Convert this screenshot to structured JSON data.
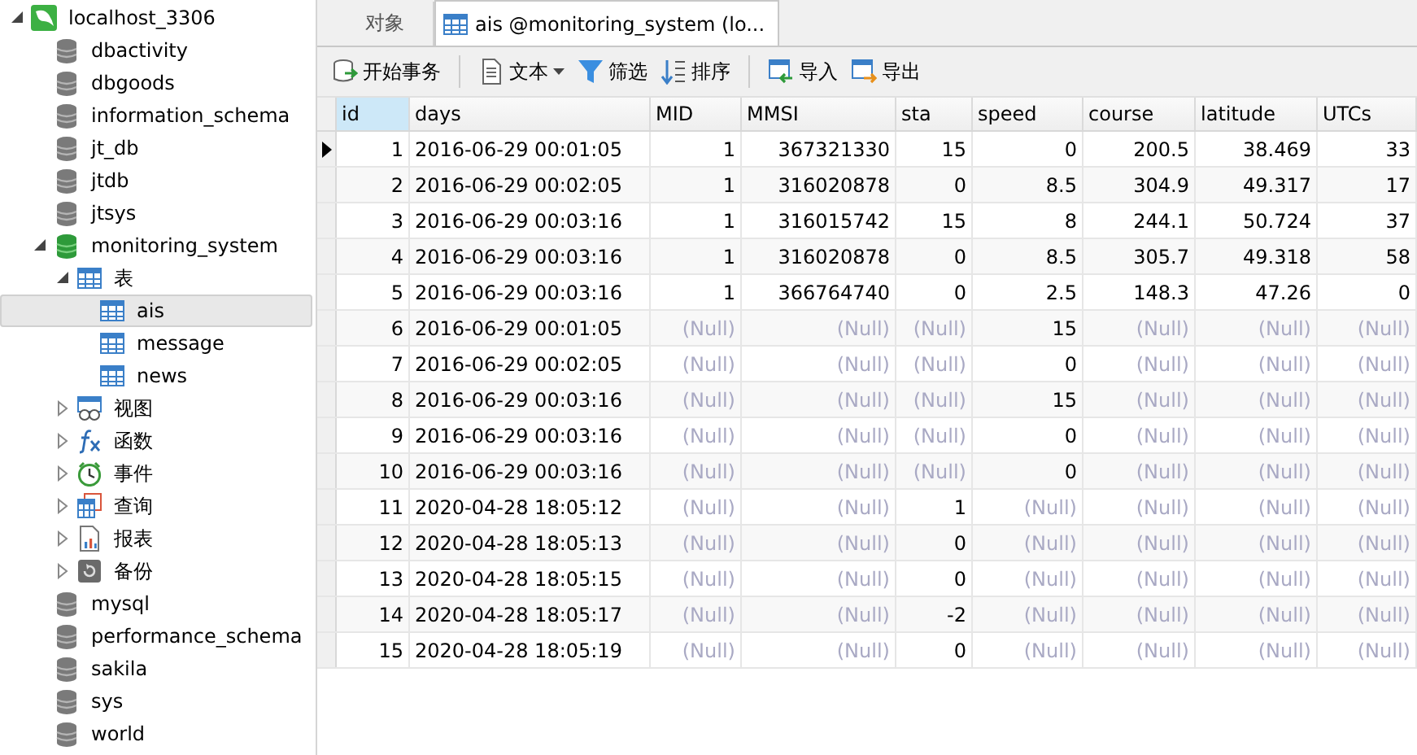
{
  "sidebar": {
    "tree": [
      {
        "kind": "server",
        "label": "localhost_3306",
        "expanded": true,
        "selected": false,
        "children": [
          {
            "kind": "database",
            "label": "dbactivity",
            "open": false,
            "selected": false
          },
          {
            "kind": "database",
            "label": "dbgoods",
            "open": false,
            "selected": false
          },
          {
            "kind": "database",
            "label": "information_schema",
            "open": false,
            "selected": false
          },
          {
            "kind": "database",
            "label": "jt_db",
            "open": false,
            "selected": false
          },
          {
            "kind": "database",
            "label": "jtdb",
            "open": false,
            "selected": false
          },
          {
            "kind": "database",
            "label": "jtsys",
            "open": false,
            "selected": false
          },
          {
            "kind": "database",
            "label": "monitoring_system",
            "open": true,
            "expanded": true,
            "selected": false,
            "children": [
              {
                "kind": "tables",
                "label": "表",
                "expanded": true,
                "selected": false,
                "children": [
                  {
                    "kind": "table",
                    "label": "ais",
                    "selected": true
                  },
                  {
                    "kind": "table",
                    "label": "message",
                    "selected": false
                  },
                  {
                    "kind": "table",
                    "label": "news",
                    "selected": false
                  }
                ]
              },
              {
                "kind": "views",
                "label": "视图",
                "expanded": false,
                "selected": false
              },
              {
                "kind": "functions",
                "label": "函数",
                "expanded": false,
                "selected": false
              },
              {
                "kind": "events",
                "label": "事件",
                "expanded": false,
                "selected": false
              },
              {
                "kind": "queries",
                "label": "查询",
                "expanded": false,
                "selected": false
              },
              {
                "kind": "reports",
                "label": "报表",
                "expanded": false,
                "selected": false
              },
              {
                "kind": "backups",
                "label": "备份",
                "expanded": false,
                "selected": false
              }
            ]
          },
          {
            "kind": "database",
            "label": "mysql",
            "open": false,
            "selected": false
          },
          {
            "kind": "database",
            "label": "performance_schema",
            "open": false,
            "selected": false
          },
          {
            "kind": "database",
            "label": "sakila",
            "open": false,
            "selected": false
          },
          {
            "kind": "database",
            "label": "sys",
            "open": false,
            "selected": false
          },
          {
            "kind": "database",
            "label": "world",
            "open": false,
            "selected": false
          }
        ]
      }
    ]
  },
  "tabs": [
    {
      "kind": "objects",
      "label": "对象",
      "selected": false
    },
    {
      "kind": "table",
      "label": "ais @monitoring_system (lo...",
      "selected": true
    }
  ],
  "toolbar": [
    {
      "kind": "transaction",
      "label": "开始事务"
    },
    {
      "kind": "separator"
    },
    {
      "kind": "text",
      "label": "文本",
      "dropdown": true
    },
    {
      "kind": "filter",
      "label": "筛选"
    },
    {
      "kind": "sort",
      "label": "排序"
    },
    {
      "kind": "separator"
    },
    {
      "kind": "import",
      "label": "导入"
    },
    {
      "kind": "export",
      "label": "导出"
    }
  ],
  "table": {
    "columns": [
      {
        "kind": "number",
        "label": "id",
        "selected": true
      },
      {
        "kind": "datetime",
        "label": "days",
        "selected": false
      },
      {
        "kind": "number",
        "label": "MID",
        "selected": false
      },
      {
        "kind": "number",
        "label": "MMSI",
        "selected": false
      },
      {
        "kind": "number",
        "label": "sta",
        "selected": false
      },
      {
        "kind": "number",
        "label": "speed",
        "selected": false
      },
      {
        "kind": "number",
        "label": "course",
        "selected": false
      },
      {
        "kind": "number",
        "label": "latitude",
        "selected": false
      },
      {
        "kind": "number",
        "label": "UTCs",
        "selected": false
      }
    ],
    "rows": [
      {
        "selected": true,
        "cells": [
          "1",
          "2016-06-29 00:01:05",
          "1",
          "367321330",
          "15",
          "0",
          "200.5",
          "38.469",
          "33"
        ]
      },
      {
        "selected": false,
        "cells": [
          "2",
          "2016-06-29 00:02:05",
          "1",
          "316020878",
          "0",
          "8.5",
          "304.9",
          "49.317",
          "17"
        ]
      },
      {
        "selected": false,
        "cells": [
          "3",
          "2016-06-29 00:03:16",
          "1",
          "316015742",
          "15",
          "8",
          "244.1",
          "50.724",
          "37"
        ]
      },
      {
        "selected": false,
        "cells": [
          "4",
          "2016-06-29 00:03:16",
          "1",
          "316020878",
          "0",
          "8.5",
          "305.7",
          "49.318",
          "58"
        ]
      },
      {
        "selected": false,
        "cells": [
          "5",
          "2016-06-29 00:03:16",
          "1",
          "366764740",
          "0",
          "2.5",
          "148.3",
          "47.26",
          "0"
        ]
      },
      {
        "selected": false,
        "cells": [
          "6",
          "2016-06-29 00:01:05",
          "(Null)",
          "(Null)",
          "(Null)",
          "15",
          "(Null)",
          "(Null)",
          "(Null)"
        ]
      },
      {
        "selected": false,
        "cells": [
          "7",
          "2016-06-29 00:02:05",
          "(Null)",
          "(Null)",
          "(Null)",
          "0",
          "(Null)",
          "(Null)",
          "(Null)"
        ]
      },
      {
        "selected": false,
        "cells": [
          "8",
          "2016-06-29 00:03:16",
          "(Null)",
          "(Null)",
          "(Null)",
          "15",
          "(Null)",
          "(Null)",
          "(Null)"
        ]
      },
      {
        "selected": false,
        "cells": [
          "9",
          "2016-06-29 00:03:16",
          "(Null)",
          "(Null)",
          "(Null)",
          "0",
          "(Null)",
          "(Null)",
          "(Null)"
        ]
      },
      {
        "selected": false,
        "cells": [
          "10",
          "2016-06-29 00:03:16",
          "(Null)",
          "(Null)",
          "(Null)",
          "0",
          "(Null)",
          "(Null)",
          "(Null)"
        ]
      },
      {
        "selected": false,
        "cells": [
          "11",
          "2020-04-28 18:05:12",
          "(Null)",
          "(Null)",
          "1",
          "(Null)",
          "(Null)",
          "(Null)",
          "(Null)"
        ]
      },
      {
        "selected": false,
        "cells": [
          "12",
          "2020-04-28 18:05:13",
          "(Null)",
          "(Null)",
          "0",
          "(Null)",
          "(Null)",
          "(Null)",
          "(Null)"
        ]
      },
      {
        "selected": false,
        "cells": [
          "13",
          "2020-04-28 18:05:15",
          "(Null)",
          "(Null)",
          "0",
          "(Null)",
          "(Null)",
          "(Null)",
          "(Null)"
        ]
      },
      {
        "selected": false,
        "cells": [
          "14",
          "2020-04-28 18:05:17",
          "(Null)",
          "(Null)",
          "-2",
          "(Null)",
          "(Null)",
          "(Null)",
          "(Null)"
        ]
      },
      {
        "selected": false,
        "cells": [
          "15",
          "2020-04-28 18:05:19",
          "(Null)",
          "(Null)",
          "0",
          "(Null)",
          "(Null)",
          "(Null)",
          "(Null)"
        ]
      }
    ]
  }
}
